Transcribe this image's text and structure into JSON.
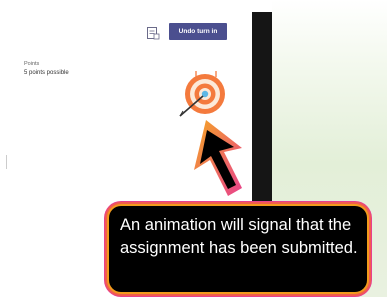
{
  "assignment": {
    "undo_button_label": "Undo turn in",
    "points_label": "Points",
    "points_value": "5 points possible"
  },
  "icons": {
    "document": "document-icon",
    "target": "target-icon",
    "arrow": "arrow-pointer-icon"
  },
  "callout": {
    "text": "An animation will signal that the assignment has been submitted."
  },
  "colors": {
    "button": "#4b4f8f",
    "target_orange": "#f47a3d",
    "target_ring_light": "#fce9d8",
    "target_center": "#5db8e6",
    "arrow_gradient_start": "#f5a623",
    "arrow_gradient_end": "#e8418c",
    "callout_background": "#000000"
  }
}
